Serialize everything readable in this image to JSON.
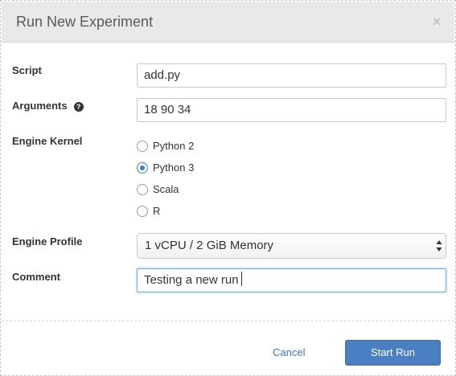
{
  "dialog": {
    "title": "Run New Experiment",
    "close_icon": "close-icon"
  },
  "form": {
    "script": {
      "label": "Script",
      "value": "add.py"
    },
    "arguments": {
      "label": "Arguments",
      "help_icon": "question-circle-icon",
      "value": "18 90 34"
    },
    "engine_kernel": {
      "label": "Engine Kernel",
      "options": [
        {
          "label": "Python 2",
          "checked": false
        },
        {
          "label": "Python 3",
          "checked": true
        },
        {
          "label": "Scala",
          "checked": false
        },
        {
          "label": "R",
          "checked": false
        }
      ]
    },
    "engine_profile": {
      "label": "Engine Profile",
      "value": "1 vCPU / 2 GiB Memory"
    },
    "comment": {
      "label": "Comment",
      "value": "Testing a new run"
    }
  },
  "footer": {
    "cancel_label": "Cancel",
    "start_label": "Start Run"
  },
  "colors": {
    "accent": "#4a7fc1",
    "link": "#3a74b8",
    "header_bg": "#e9e9e9",
    "radio_checked": "#3b7ddd"
  }
}
